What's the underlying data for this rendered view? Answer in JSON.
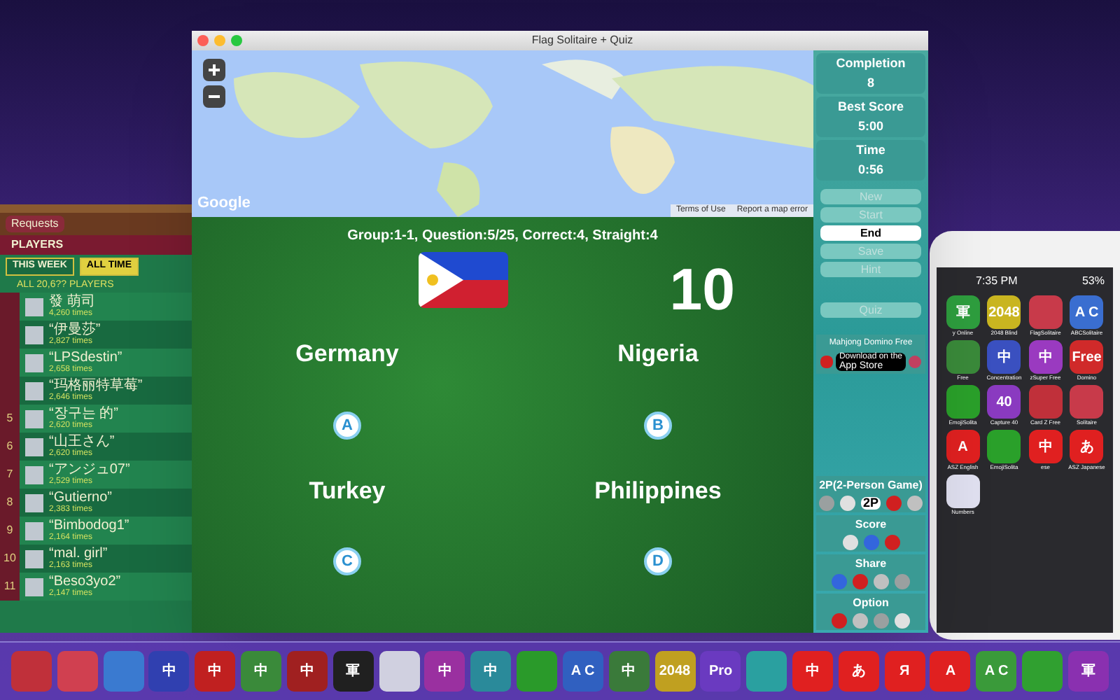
{
  "leaderboard": {
    "tabs": [
      {
        "label": "Requests",
        "selected": false
      }
    ],
    "section": "PLAYERS",
    "periods": [
      {
        "label": "THIS WEEK",
        "selected": false
      },
      {
        "label": "ALL TIME",
        "selected": true
      }
    ],
    "summary": "ALL 20,6?? PLAYERS",
    "rows": [
      {
        "name": "發 萌司",
        "score": "4,260 times"
      },
      {
        "name": "“伊曼莎”",
        "score": "2,827 times"
      },
      {
        "name": "“LPSdestin”",
        "score": "2,658 times"
      },
      {
        "name": "“玛格丽特草莓”",
        "score": "2,646 times"
      },
      {
        "rank": "5",
        "name": "“장구는 的”",
        "score": "2,620 times"
      },
      {
        "rank": "6",
        "name": "“山王さん”",
        "score": "2,620 times"
      },
      {
        "rank": "7",
        "name": "“アンジュ07”",
        "score": "2,529 times"
      },
      {
        "rank": "8",
        "name": "“Gutierno”",
        "score": "2,383 times"
      },
      {
        "rank": "9",
        "name": "“Bimbodog1”",
        "score": "2,164 times"
      },
      {
        "rank": "10",
        "name": "“mal. girl”",
        "score": "2,163 times"
      },
      {
        "rank": "11",
        "name": "“Beso3yo2”",
        "score": "2,147 times"
      }
    ]
  },
  "window": {
    "title": "Flag Solitaire + Quiz"
  },
  "map": {
    "attribution": "Google",
    "links": [
      "Terms of Use",
      "Report a map error"
    ]
  },
  "game": {
    "status": "Group:1-1, Question:5/25, Correct:4, Straight:4",
    "score": "10",
    "answers": [
      {
        "name": "Germany",
        "letter": "A"
      },
      {
        "name": "Nigeria",
        "letter": "B"
      },
      {
        "name": "Turkey",
        "letter": "C"
      },
      {
        "name": "Philippines",
        "letter": "D"
      }
    ]
  },
  "sidebar": {
    "stats": [
      {
        "label": "Completion",
        "value": "8"
      },
      {
        "label": "Best Score",
        "value": "5:00"
      },
      {
        "label": "Time",
        "value": "0:56"
      }
    ],
    "buttons": [
      {
        "label": "New",
        "disabled": true,
        "selected": false
      },
      {
        "label": "Start",
        "disabled": true,
        "selected": false
      },
      {
        "label": "End",
        "disabled": false,
        "selected": true
      },
      {
        "label": "Save",
        "disabled": true,
        "selected": false
      },
      {
        "label": "Hint",
        "disabled": true,
        "selected": false
      },
      {
        "label": "Quiz",
        "disabled": true,
        "selected": false
      }
    ],
    "ad": {
      "title": "Mahjong Domino Free",
      "store_top": "Download on the",
      "store": "App Store"
    },
    "sections": [
      {
        "title": "2P(2-Person Game)",
        "icons": [
          {
            "kind": "round"
          },
          {
            "kind": "round"
          },
          {
            "kind": "text",
            "text": "2P"
          },
          {
            "kind": "round"
          },
          {
            "kind": "round"
          }
        ]
      },
      {
        "title": "Score",
        "icons": [
          {
            "kind": "round"
          },
          {
            "kind": "round"
          },
          {
            "kind": "round"
          }
        ]
      },
      {
        "title": "Share",
        "icons": [
          {
            "kind": "round"
          },
          {
            "kind": "round"
          },
          {
            "kind": "round"
          },
          {
            "kind": "round"
          }
        ]
      },
      {
        "title": "Option",
        "icons": [
          {
            "kind": "round"
          },
          {
            "kind": "round"
          },
          {
            "kind": "round"
          },
          {
            "kind": "round"
          }
        ]
      }
    ]
  },
  "phone": {
    "time": "7:35 PM",
    "battery": "53%",
    "apps": [
      {
        "label": "y Online",
        "glyph": "軍",
        "color": "#2e9e3e"
      },
      {
        "label": "2048 Blind",
        "glyph": "2048",
        "color": "#c9b520"
      },
      {
        "label": "FlagSolitaire",
        "color": "#c83a4a"
      },
      {
        "label": "ABCSolitaire",
        "glyph": "A C",
        "color": "#3a6ed0"
      },
      {
        "label": "Free",
        "color": "#3a8a3a"
      },
      {
        "label": "Concentration",
        "glyph": "中",
        "color": "#3a50c0"
      },
      {
        "label": "zSuper Free",
        "glyph": "中",
        "color": "#9a3ac0"
      },
      {
        "label": "Domino",
        "glyph": "Free",
        "color": "#d02a2a"
      },
      {
        "label": "EmojiSolita",
        "color": "#2aa02a"
      },
      {
        "label": "Capture 40",
        "glyph": "40",
        "color": "#8a3ac0"
      },
      {
        "label": "Card Z Free",
        "color": "#c0303a"
      },
      {
        "label": "Solitaire",
        "color": "#c83a4a"
      },
      {
        "label": "ASZ English",
        "glyph": "A",
        "color": "#e02020"
      },
      {
        "label": "EmojiSolita",
        "color": "#2aa02a"
      },
      {
        "label": "ese",
        "glyph": "中",
        "color": "#e02020"
      },
      {
        "label": "ASZ Japanese",
        "glyph": "あ",
        "color": "#e02020"
      },
      {
        "label": "Numbers",
        "color": "#e0e0f0"
      }
    ]
  },
  "dock": [
    {
      "color": "#c0303a"
    },
    {
      "color": "#d04050"
    },
    {
      "color": "#3a7ad0"
    },
    {
      "glyph": "中",
      "color": "#3040b0"
    },
    {
      "glyph": "中",
      "color": "#c02020"
    },
    {
      "glyph": "中",
      "color": "#3a8a3a"
    },
    {
      "glyph": "中",
      "color": "#a02020"
    },
    {
      "glyph": "軍",
      "color": "#202020"
    },
    {
      "color": "#d0d0e0"
    },
    {
      "glyph": "中",
      "color": "#9a30a0"
    },
    {
      "glyph": "中",
      "color": "#2a8a9a"
    },
    {
      "color": "#2a9a2a"
    },
    {
      "glyph": "A C",
      "color": "#3060c0"
    },
    {
      "glyph": "中",
      "color": "#3a7a3a"
    },
    {
      "glyph": "2048",
      "color": "#c0a020"
    },
    {
      "glyph": "Pro",
      "color": "#6a3ac0"
    },
    {
      "color": "#2aa0a0"
    },
    {
      "glyph": "中",
      "color": "#e02020"
    },
    {
      "glyph": "あ",
      "color": "#e02020"
    },
    {
      "glyph": "Я",
      "color": "#e02020"
    },
    {
      "glyph": "A",
      "color": "#e02020"
    },
    {
      "glyph": "A C",
      "color": "#3a9a3a"
    },
    {
      "color": "#30a030"
    },
    {
      "glyph": "軍",
      "color": "#8a30b0"
    }
  ]
}
